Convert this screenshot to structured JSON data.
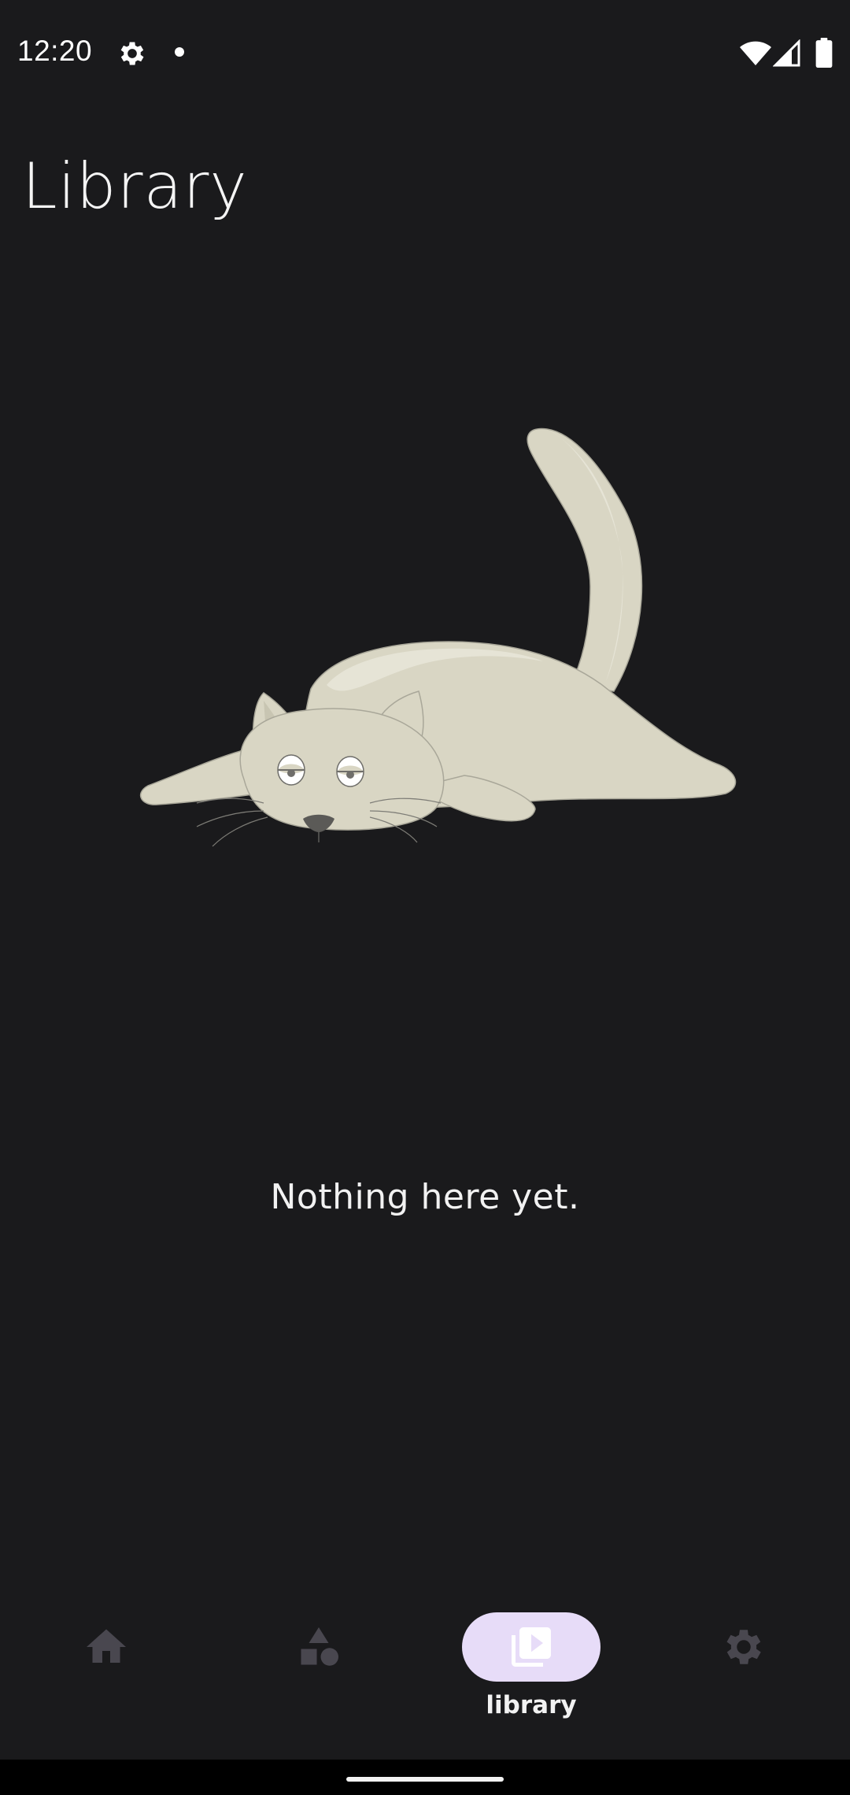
{
  "status_bar": {
    "time": "12:20",
    "icons": [
      "gear-icon",
      "notification-dot-icon",
      "wifi-icon",
      "cell-signal-icon",
      "battery-icon"
    ]
  },
  "page": {
    "title": "Library",
    "empty_message": "Nothing here yet."
  },
  "illustration": {
    "subject": "sleepy-cat-illustration",
    "body_color": "#d9d6c4",
    "shade_color": "#e6e4d6"
  },
  "bottom_nav": {
    "items": [
      {
        "id": "home",
        "icon": "home-icon",
        "label": "",
        "active": false
      },
      {
        "id": "explore",
        "icon": "shapes-icon",
        "label": "",
        "active": false
      },
      {
        "id": "library",
        "icon": "video-library-icon",
        "label": "library",
        "active": true
      },
      {
        "id": "settings",
        "icon": "gear-icon",
        "label": "",
        "active": false
      }
    ],
    "active_pill_color": "#e7dcf8",
    "inactive_icon_color": "#49474f"
  },
  "colors": {
    "background": "#1a1a1c",
    "text": "#ffffff"
  }
}
